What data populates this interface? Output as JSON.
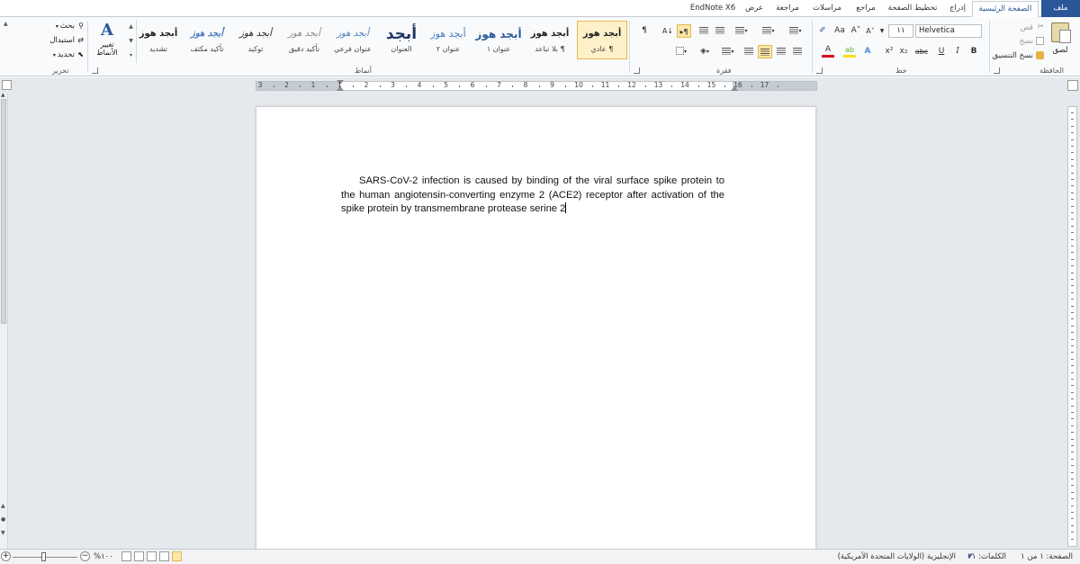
{
  "tabs": {
    "file": "ملف",
    "home": "الصفحة الرئيسية",
    "insert": "إدراج",
    "page_layout": "تخطيط الصفحة",
    "references": "مراجع",
    "mailings": "مراسلات",
    "review": "مراجعة",
    "view": "عرض",
    "endnote": "EndNote X6"
  },
  "clipboard": {
    "paste": "لصق",
    "cut": "قص",
    "copy": "نسخ",
    "format_painter": "نسخ التنسيق",
    "group_label": "الحافظة"
  },
  "font": {
    "name": "Helvetica",
    "size": "١١",
    "group_label": "خط",
    "grow": "A˄",
    "shrink": "A˅",
    "change_case": "Aa",
    "bold": "B",
    "italic": "I",
    "underline": "U",
    "strike": "abc",
    "subscript": "x₂",
    "superscript": "x²",
    "font_color": "A",
    "text_effects": "A"
  },
  "paragraph": {
    "group_label": "فقرة",
    "show_marks": "¶"
  },
  "styles": {
    "group_label": "أنماط",
    "items": [
      {
        "preview": "أبجد هوز",
        "name": "¶ عادي"
      },
      {
        "preview": "أبجد هوز",
        "name": "¶ بلا تباعد"
      },
      {
        "preview": "أبجد هوز",
        "name": "عنوان ١"
      },
      {
        "preview": "أبجد هوز",
        "name": "عنوان ٢"
      },
      {
        "preview": "أبجد",
        "name": "العنوان"
      },
      {
        "preview": "أبجد هوز",
        "name": "عنوان فرعي"
      },
      {
        "preview": "أبجد هوز",
        "name": "تأكيد دقيق"
      },
      {
        "preview": "أبجد هوز",
        "name": "توكيد"
      },
      {
        "preview": "أبجد هوز",
        "name": "تأكيد مكثف"
      },
      {
        "preview": "أبجد هوز",
        "name": "تشديد"
      }
    ],
    "change_styles": "تغيير الأنماط"
  },
  "editing": {
    "find": "بحث",
    "replace": "استبدال",
    "select": "تحديد",
    "group_label": "تحرير"
  },
  "ruler": {
    "numbers": [
      "3",
      "2",
      "1",
      "1",
      "2",
      "3",
      "4",
      "5",
      "6",
      "7",
      "8",
      "9",
      "10",
      "11",
      "12",
      "13",
      "14",
      "15",
      "16",
      "17"
    ]
  },
  "document": {
    "text": "SARS-CoV-2 infection is caused by binding of the viral surface spike protein to the human angiotensin-converting enzyme 2 (ACE2) receptor after activation of the spike protein by transmembrane protease serine 2"
  },
  "status": {
    "page": "الصفحة: ١ من ١",
    "words": "الكلمات: ٣١",
    "language": "الإنجليزية (الولايات المتحدة الأمريكية)",
    "zoom": "%١٠٠"
  },
  "colors": {
    "accent": "#2b579a",
    "highlight": "#fce6a8",
    "workspace": "#e5e8ec",
    "font_color_bar": "#d3121b",
    "highlight_bar": "#f3e11b"
  }
}
